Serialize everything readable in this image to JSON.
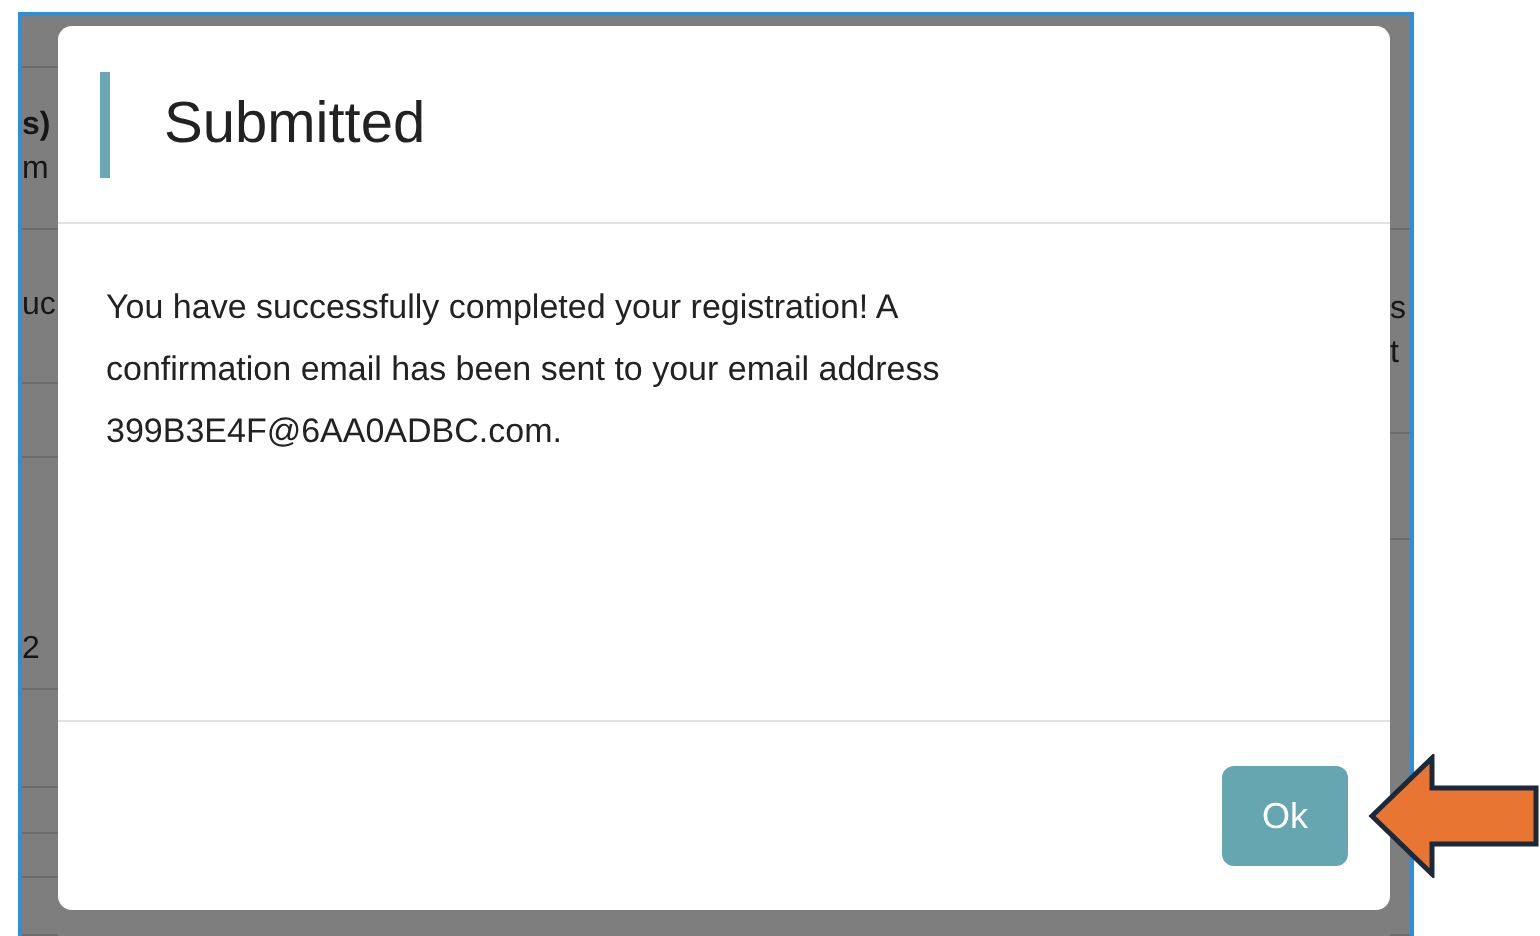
{
  "background_page": {
    "left_rows": [
      {
        "lines": []
      },
      {
        "lines": [
          {
            "text": "s)",
            "bold": true
          },
          {
            "text": "m",
            "bold": false
          }
        ]
      },
      {
        "lines": [
          {
            "text": "uc",
            "bold": false
          }
        ]
      },
      {
        "lines": []
      },
      {
        "lines": [
          {
            "text": "2",
            "bold": false
          }
        ]
      },
      {
        "lines": []
      },
      {
        "lines": []
      },
      {
        "lines": []
      },
      {
        "lines": []
      }
    ],
    "right_rows": [
      {
        "lines": []
      },
      {
        "lines": [
          {
            "text": "s",
            "bold": false
          },
          {
            "text": "t",
            "bold": false
          }
        ]
      },
      {
        "lines": []
      },
      {
        "lines": []
      }
    ]
  },
  "dialog": {
    "title": "Submitted",
    "message": "You have successfully completed your registration! A confirmation email has been sent to your email address 399B3E4F@6AA0ADBC.com.",
    "buttons": [
      "Ok"
    ]
  }
}
